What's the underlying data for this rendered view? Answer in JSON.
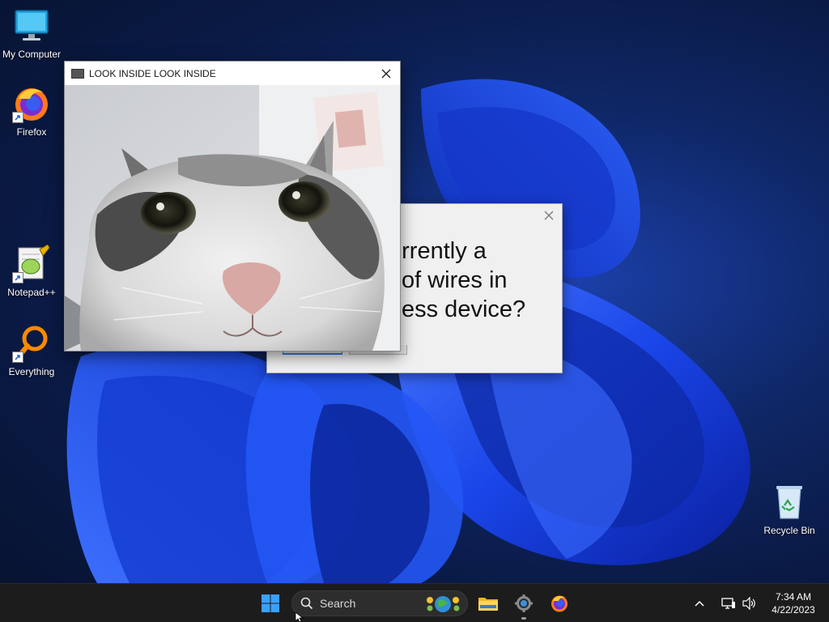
{
  "desktop": {
    "icons": [
      {
        "label": "My Computer",
        "icon": "monitor-icon"
      },
      {
        "label": "Firefox",
        "icon": "firefox-icon"
      },
      {
        "label": "Notepad++",
        "icon": "notepadpp-icon"
      },
      {
        "label": "Everything",
        "icon": "everything-search-icon"
      },
      {
        "label": "Recycle Bin",
        "icon": "recycle-bin-icon"
      }
    ]
  },
  "cat_window": {
    "title": "LOOK INSIDE LOOK INSIDE",
    "close_glyph": "✕"
  },
  "question_dialog": {
    "lines": [
      "urrently a",
      "of wires in",
      "ess device?"
    ],
    "close_glyph": "✕"
  },
  "taskbar": {
    "search_placeholder": "Search",
    "pinned": [
      "start-icon",
      "file-explorer-icon",
      "settings-icon",
      "firefox-icon"
    ],
    "clock_time": "7:34 AM",
    "clock_date": "4/22/2023"
  },
  "colors": {
    "wallpaper_blue": "#1e4fff",
    "taskbar": "#1c1c1c",
    "windows_accent": "#3aa0ff"
  }
}
